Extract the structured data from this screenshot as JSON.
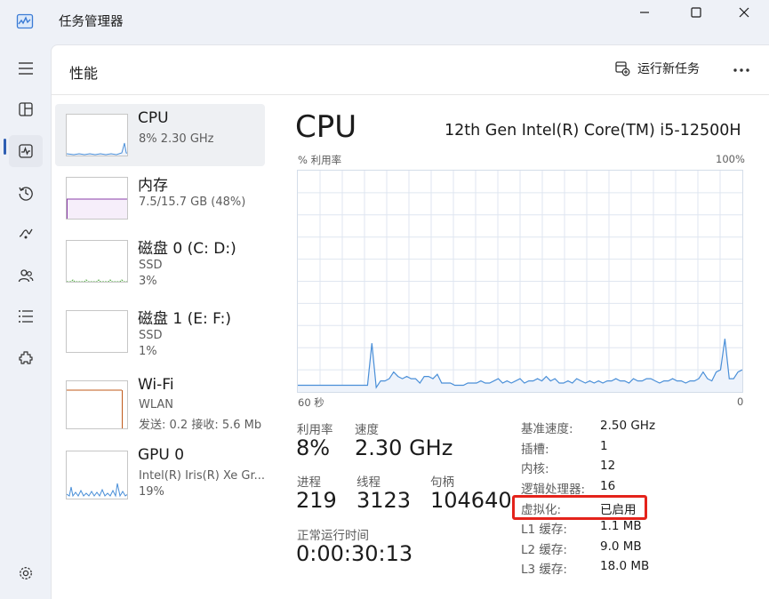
{
  "app": {
    "title": "任务管理器",
    "icon": "task-manager-icon"
  },
  "window_controls": [
    "minimize-icon",
    "maximize-icon",
    "close-icon"
  ],
  "nav": {
    "items": [
      {
        "icon": "hamburger-icon"
      },
      {
        "icon": "processes-icon"
      },
      {
        "icon": "performance-icon",
        "active": true
      },
      {
        "icon": "app-history-icon"
      },
      {
        "icon": "startup-apps-icon"
      },
      {
        "icon": "users-icon"
      },
      {
        "icon": "details-icon"
      },
      {
        "icon": "services-icon"
      },
      {
        "icon": "settings-icon"
      }
    ]
  },
  "header": {
    "title": "性能",
    "run_task_label": "运行新任务",
    "more_icon": "more-icon"
  },
  "devices": [
    {
      "name": "CPU",
      "sub1": "8% 2.30 GHz",
      "sub2": "",
      "sub3": ""
    },
    {
      "name": "内存",
      "sub1": "7.5/15.7 GB (48%)",
      "sub2": "",
      "sub3": ""
    },
    {
      "name": "磁盘 0 (C: D:)",
      "sub1": "SSD",
      "sub2": "3%",
      "sub3": ""
    },
    {
      "name": "磁盘 1 (E: F:)",
      "sub1": "SSD",
      "sub2": "1%",
      "sub3": ""
    },
    {
      "name": "Wi-Fi",
      "sub1": "WLAN",
      "sub2": "发送: 0.2 接收: 5.6 Mb",
      "sub3": ""
    },
    {
      "name": "GPU 0",
      "sub1": "Intel(R) Iris(R) Xe Gr...",
      "sub2": "19%",
      "sub3": ""
    }
  ],
  "detail": {
    "title": "CPU",
    "model": "12th Gen Intel(R) Core(TM) i5-12500H",
    "graph": {
      "y_label": "% 利用率",
      "y_max_label": "100%",
      "x_left_label": "60 秒",
      "x_right_label": "0",
      "utilization_percent": [
        3,
        3,
        3,
        3,
        3,
        3,
        3,
        3,
        3,
        3,
        3,
        3,
        3,
        3,
        3,
        3,
        3,
        22,
        2,
        5,
        5,
        6,
        9,
        7,
        6,
        7,
        6,
        6,
        4,
        7,
        7,
        6,
        8,
        4,
        4,
        4,
        3,
        3,
        3,
        4,
        4,
        4,
        5,
        4,
        4,
        5,
        6,
        4,
        5,
        4,
        5,
        6,
        4,
        5,
        5,
        6,
        5,
        7,
        5,
        6,
        4,
        4,
        5,
        4,
        6,
        5,
        4,
        5,
        4,
        5,
        4,
        5,
        5,
        6,
        5,
        5,
        4,
        6,
        5,
        5,
        6,
        6,
        5,
        4,
        5,
        5,
        6,
        5,
        5,
        4,
        5,
        5,
        6,
        9,
        6,
        5,
        9,
        10,
        24,
        6,
        6,
        9,
        10
      ],
      "fill_color": "#eef3fb",
      "line_color": "#4a8fd8",
      "grid_color": "#dfe6f0"
    },
    "stats": {
      "util_label": "利用率",
      "util_value": "8%",
      "speed_label": "速度",
      "speed_value": "2.30 GHz",
      "proc_label": "进程",
      "proc_value": "219",
      "threads_label": "线程",
      "threads_value": "3123",
      "handles_label": "句柄",
      "handles_value": "104640",
      "uptime_label": "正常运行时间",
      "uptime_value": "0:00:30:13"
    },
    "specs": [
      {
        "label": "基准速度:",
        "value": "2.50 GHz"
      },
      {
        "label": "插槽:",
        "value": "1"
      },
      {
        "label": "内核:",
        "value": "12"
      },
      {
        "label": "逻辑处理器:",
        "value": "16"
      },
      {
        "label": "虚拟化:",
        "value": "已启用",
        "highlighted": true
      },
      {
        "label": "L1 缓存:",
        "value": "1.1 MB"
      },
      {
        "label": "L2 缓存:",
        "value": "9.0 MB"
      },
      {
        "label": "L3 缓存:",
        "value": "18.0 MB"
      }
    ],
    "highlight_color": "#e4231b"
  },
  "colors": {
    "cpu_thumb": "#4a8fd8",
    "memory_thumb": "#8b3fa8",
    "disk_thumb": "#4fa83f",
    "wifi_thumb": "#c0591a",
    "gpu_thumb": "#4a8fd8",
    "nav_indicator": "#2f5fb3"
  }
}
